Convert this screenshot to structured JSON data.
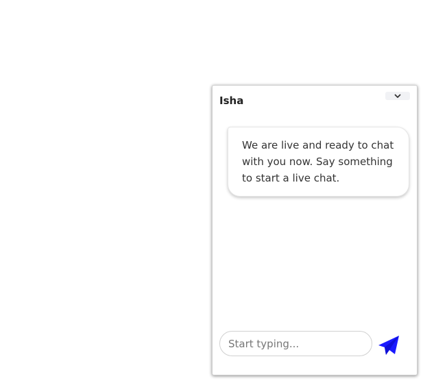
{
  "chat": {
    "agent_name": "Isha",
    "welcome_message": "We are live and ready to chat with you now. Say something to start a live chat.",
    "input_placeholder": "Start typing...",
    "input_value": "",
    "icons": {
      "minimize": "chevron-down-icon",
      "send": "paper-plane-icon"
    },
    "colors": {
      "send_icon": "#1a1aff",
      "header_text": "#222222",
      "message_text": "#333333"
    }
  }
}
